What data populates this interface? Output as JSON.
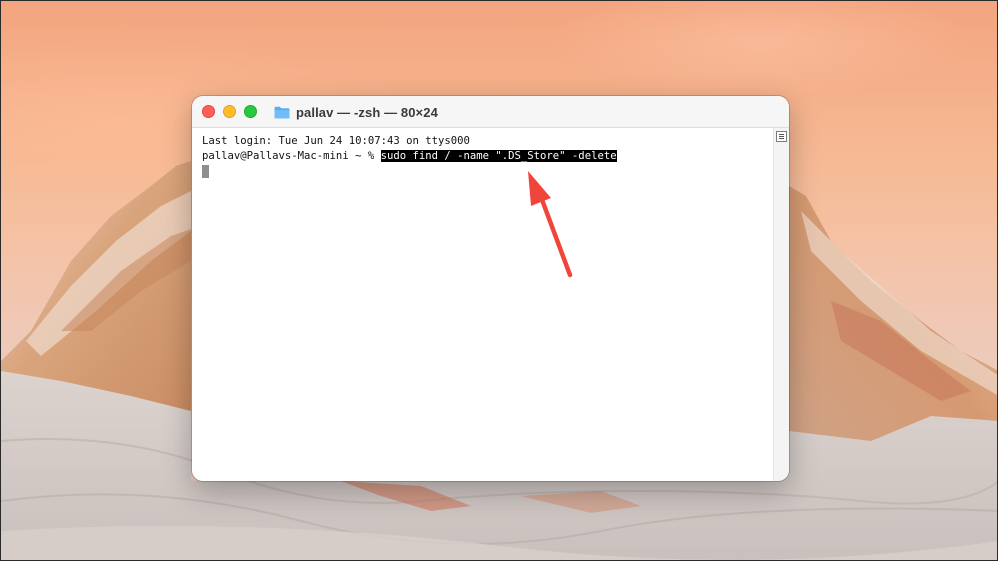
{
  "window": {
    "title": "pallav — -zsh — 80×24"
  },
  "terminal": {
    "lines": [
      {
        "text": "Last login: Tue Jun 24 10:07:43 on ttys000"
      }
    ],
    "prompt": "pallav@Pallavs-Mac-mini ~ % ",
    "command": "sudo find / -name \".DS_Store\" -delete"
  },
  "icons": {
    "titlebar_folder": "folder-icon",
    "annotation": "red-arrow-icon",
    "scroll_grip": "scroll-grip-icon"
  },
  "colors": {
    "close": "#ff5f57",
    "minimize": "#febc2e",
    "maximize": "#28c840",
    "annotation_arrow": "#f0453a",
    "selection_bg": "#000000"
  }
}
